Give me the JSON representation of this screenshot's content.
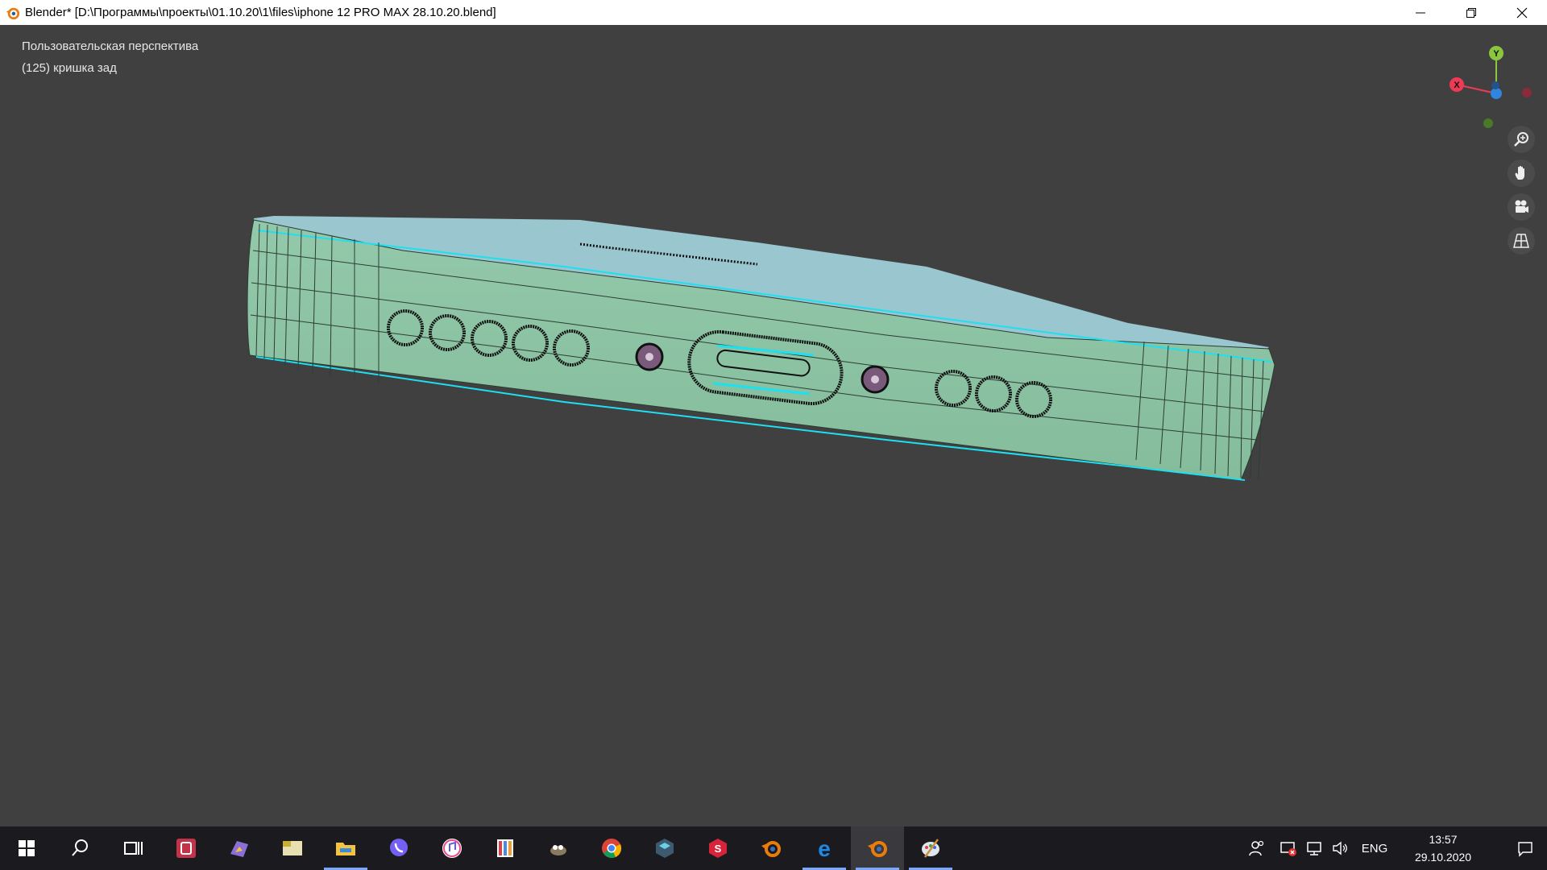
{
  "window": {
    "title": "Blender* [D:\\Программы\\проекты\\01.10.20\\1\\files\\iphone 12 PRO MAX 28.10.20.blend]",
    "controls": [
      "minimize",
      "restore",
      "close"
    ]
  },
  "viewport": {
    "view_name": "Пользовательская перспектива",
    "object_info": "(125) кришка зад",
    "gizmo": {
      "axes": [
        {
          "label": "Y",
          "color": "#8cc63f"
        },
        {
          "label": "X",
          "color": "#ee3a55"
        },
        {
          "label": "",
          "color": "#2e86de"
        }
      ]
    },
    "nav_tools": [
      "zoom-icon",
      "pan-hand-icon",
      "camera-icon",
      "grid-view-icon"
    ]
  },
  "colors": {
    "background": "#404040",
    "side_face": "#8fc5a6",
    "top_face": "#9ac6cf",
    "selected_edge": "#1de0f0",
    "vertex": "#111111"
  },
  "taskbar": {
    "apps": [
      "start-icon",
      "search-icon",
      "task-view-icon",
      "recorder-app-icon",
      "image-app-icon",
      "ninety-nine-app-icon",
      "file-explorer-icon",
      "viber-icon",
      "itunes-icon",
      "office-app-icon",
      "gimp-icon",
      "chrome-icon",
      "layers-app-icon",
      "substance-icon",
      "blender-icon",
      "edge-icon",
      "blender-icon",
      "paint-app-icon"
    ],
    "tray": {
      "language": "ENG",
      "time": "13:57",
      "date": "29.10.2020"
    }
  }
}
